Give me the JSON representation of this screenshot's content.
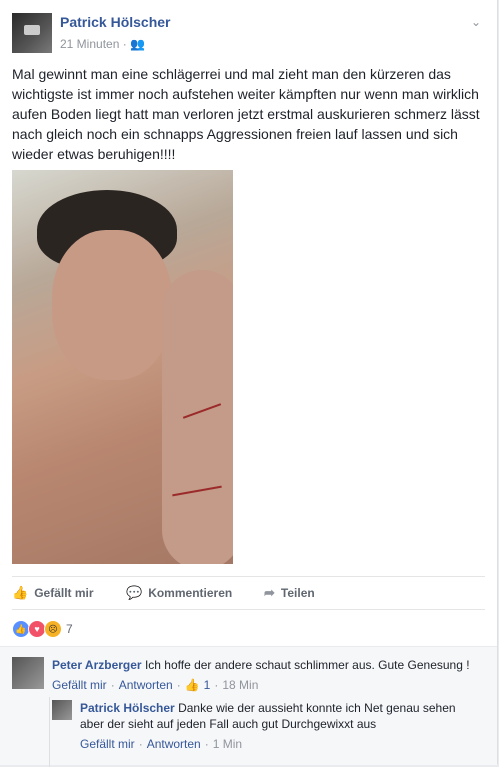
{
  "post": {
    "author": "Patrick Hölscher",
    "time": "21 Minuten",
    "audience_icon": "friends-icon",
    "text": "Mal gewinnt man eine schlägerrei und mal zieht man den kürzeren das wichtigste ist immer noch aufstehen weiter kämpften nur wenn man wirklich aufen Boden liegt hatt man verloren jetzt erstmal auskurieren schmerz lässt nach gleich noch ein schnapps Aggressionen freien lauf lassen und sich wieder etwas beruhigen!!!!"
  },
  "actions": {
    "like": "Gefällt mir",
    "comment": "Kommentieren",
    "share": "Teilen"
  },
  "reactions": {
    "count": "7"
  },
  "comments": [
    {
      "author": "Peter Arzberger",
      "text": "Ich hoffe der andere schaut schlimmer aus. Gute Genesung !",
      "like": "Gefällt mir",
      "reply": "Antworten",
      "likes": "1",
      "time": "18 Min"
    },
    {
      "author": "Patrick Hölscher",
      "text": "Danke wie der aussieht konnte ich Net genau sehen aber der sieht auf jeden Fall auch gut Durchgewixxt aus",
      "like": "Gefällt mir",
      "reply": "Antworten",
      "time": "1 Min"
    }
  ],
  "colors": {
    "link": "#365899",
    "muted": "#90949c",
    "like_blue": "#5890ff"
  }
}
